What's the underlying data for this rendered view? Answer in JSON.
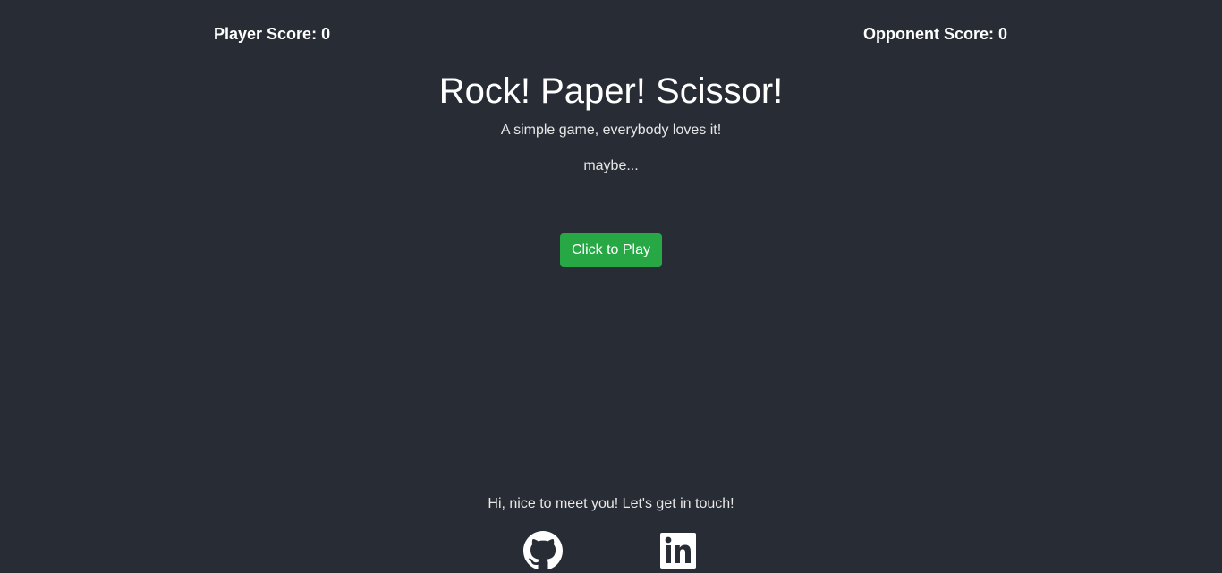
{
  "header": {
    "player_score_label": "Player Score: 0",
    "opponent_score_label": "Opponent Score: 0"
  },
  "main": {
    "title": "Rock! Paper! Scissor!",
    "subtitle": "A simple game, everybody loves it!",
    "tagline": "maybe...",
    "play_button_label": "Click to Play"
  },
  "footer": {
    "contact_text": "Hi, nice to meet you! Let's get in touch!",
    "social_icons": [
      "github-icon",
      "linkedin-icon"
    ]
  },
  "colors": {
    "background": "#282c34",
    "play_button": "#28a745",
    "text": "#ffffff"
  }
}
